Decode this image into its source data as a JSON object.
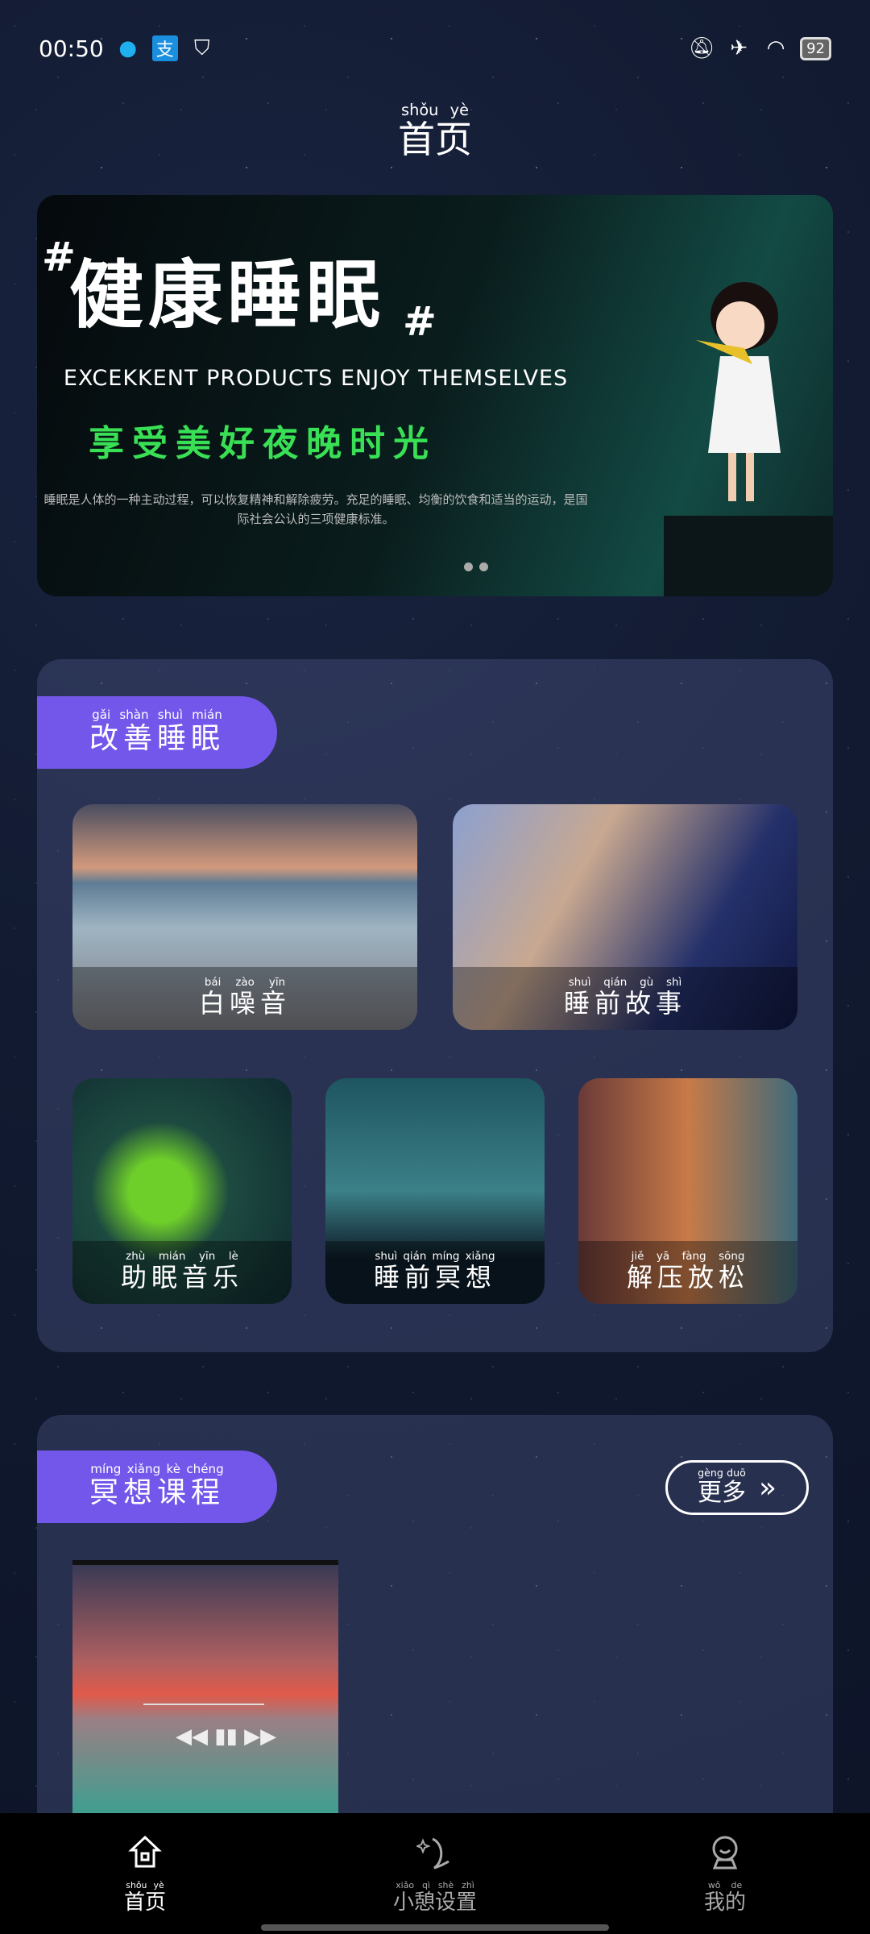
{
  "status_bar": {
    "time": "00:50",
    "battery": "92",
    "icons": [
      "qq-icon",
      "alipay-icon",
      "shield-icon",
      "bell-off-icon",
      "airplane-icon",
      "wifi-icon",
      "battery-icon"
    ]
  },
  "header": {
    "title": "首页",
    "title_pinyin": "shǒu yè"
  },
  "banner": {
    "headline": "健康睡眠",
    "hash": "#",
    "subtitle_en": "EXCEKKENT PRODUCTS ENJOY THEMSELVES",
    "subtitle_cn": "享受美好夜晚时光",
    "description": "睡眠是人体的一种主动过程，可以恢复精神和解除疲劳。充足的睡眠、均衡的饮食和适当的运动，是国际社会公认的三项健康标准。",
    "page_count": 2
  },
  "improve_sleep": {
    "label": "改善睡眠",
    "label_pinyin": "gǎi shàn shuì mián",
    "items": [
      {
        "label": "白噪音",
        "pinyin": "bái zào yīn"
      },
      {
        "label": "睡前故事",
        "pinyin": "shuì qián gù shì"
      },
      {
        "label": "助眠音乐",
        "pinyin": "zhù mián yīn lè"
      },
      {
        "label": "睡前冥想",
        "pinyin": "shuì qián míng xiǎng"
      },
      {
        "label": "解压放松",
        "pinyin": "jiě yā fàng sōng"
      }
    ]
  },
  "meditation": {
    "label": "冥想课程",
    "label_pinyin": "míng xiǎng kè chéng",
    "more_label": "更多",
    "more_pinyin": "gèng duō"
  },
  "nav": [
    {
      "label": "首页",
      "pinyin": "shǒu yè",
      "icon": "home-icon",
      "active": true
    },
    {
      "label": "小憩设置",
      "pinyin": "xiǎo qì shè zhì",
      "icon": "moon-icon",
      "active": false
    },
    {
      "label": "我的",
      "pinyin": "wǒ de",
      "icon": "profile-icon",
      "active": false
    }
  ]
}
